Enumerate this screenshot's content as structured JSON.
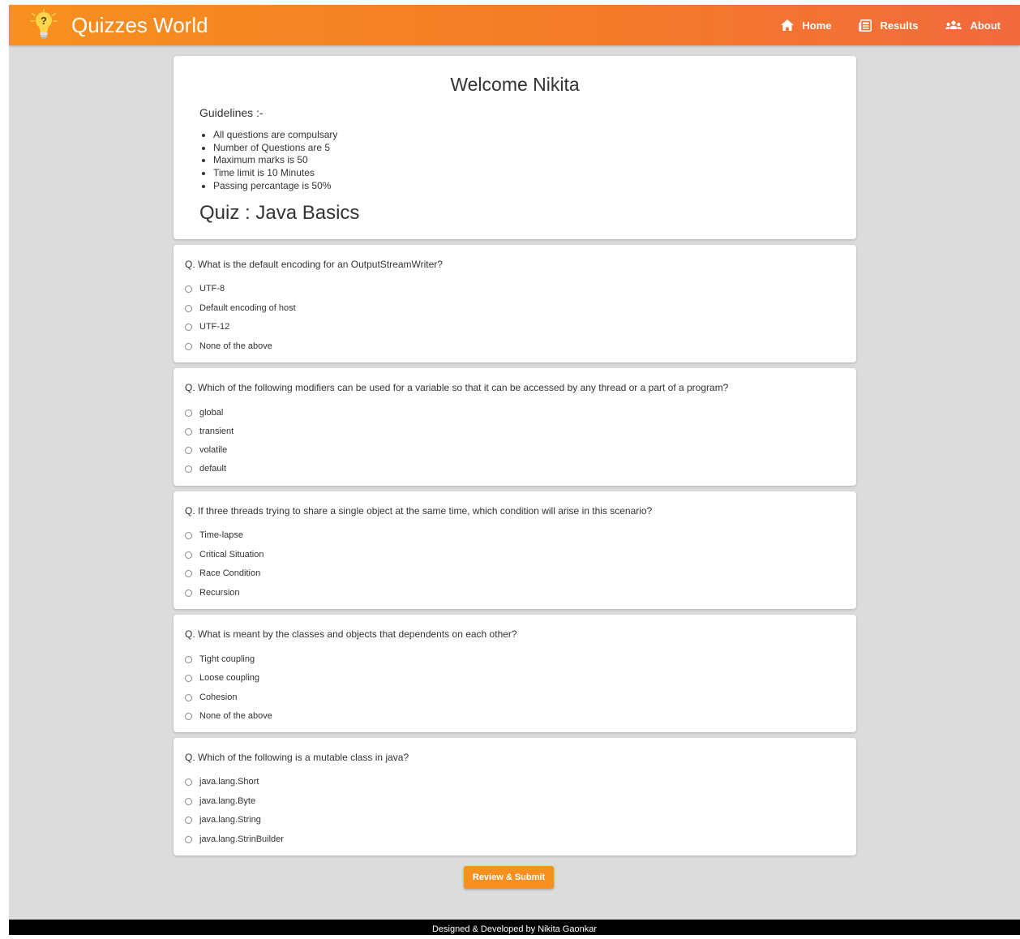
{
  "navbar": {
    "brand": "Quizzes World",
    "links": [
      {
        "label": "Home",
        "icon": "home-icon"
      },
      {
        "label": "Results",
        "icon": "results-icon"
      },
      {
        "label": "About",
        "icon": "users-icon"
      }
    ],
    "accent_color": "#f7901e"
  },
  "intro": {
    "welcome": "Welcome Nikita",
    "guidelines_title": "Guidelines :-",
    "rules": [
      "All questions are compulsary",
      "Number of Questions are 5",
      "Maximum marks is 50",
      "Time limit is 10 Minutes",
      "Passing percantage is 50%"
    ],
    "quiz_title": "Quiz : Java Basics"
  },
  "questions": [
    {
      "text": "Q. What is the default encoding for an OutputStreamWriter?",
      "options": [
        "UTF-8",
        "Default encoding of host",
        "UTF-12",
        "None of the above"
      ]
    },
    {
      "text": "Q. Which of the following modifiers can be used for a variable so that it can be accessed by any thread or a part of a program?",
      "options": [
        "global",
        "transient",
        "volatile",
        "default"
      ]
    },
    {
      "text": "Q. If three threads trying to share a single object at the same time, which condition will arise in this scenario?",
      "options": [
        "Time-lapse",
        "Critical Situation",
        "Race Condition",
        "Recursion"
      ]
    },
    {
      "text": "Q. What is meant by the classes and objects that dependents on each other?",
      "options": [
        "Tight coupling",
        "Loose coupling",
        "Cohesion",
        "None of the above"
      ]
    },
    {
      "text": "Q. Which of the following is a mutable class in java?",
      "options": [
        "java.lang.Short",
        "java.lang.Byte",
        "java.lang.String",
        "java.lang.StrinBuilder"
      ]
    }
  ],
  "submit_label": "Review & Submit",
  "footer": "Designed & Developed by Nikita Gaonkar"
}
